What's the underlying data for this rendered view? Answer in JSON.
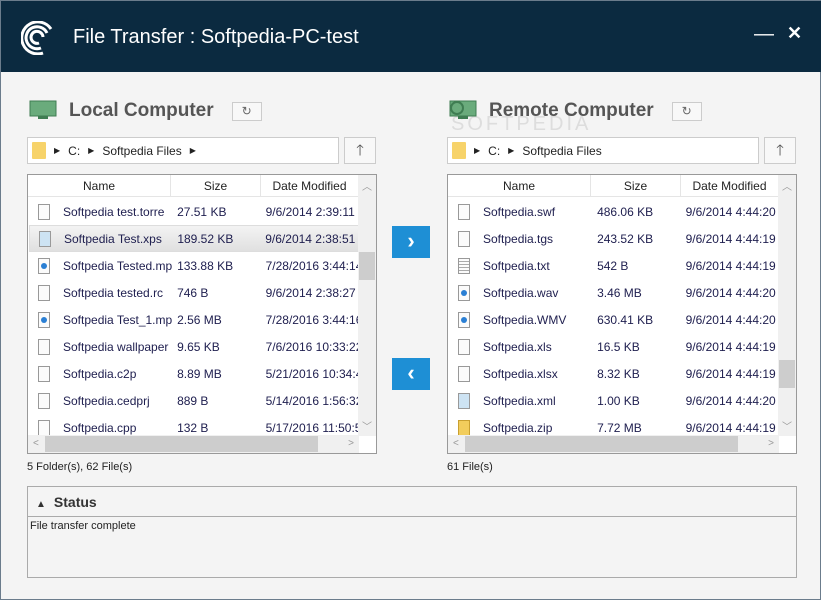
{
  "window": {
    "title": "File Transfer : Softpedia-PC-test",
    "minimize": "—",
    "close": "✕"
  },
  "local": {
    "title": "Local Computer",
    "refresh": "↻",
    "crumbs": [
      "C:",
      "Softpedia Files"
    ],
    "up": "🡑",
    "columns": [
      "Name",
      "Size",
      "Date Modified"
    ],
    "rows": [
      {
        "icon": "file",
        "name": "Softpedia test.torre",
        "size": "27.51 KB",
        "date": "9/6/2014 2:39:11"
      },
      {
        "icon": "img",
        "name": "Softpedia Test.xps",
        "size": "189.52 KB",
        "date": "9/6/2014 2:38:51",
        "selected": true
      },
      {
        "icon": "media",
        "name": "Softpedia Tested.mp",
        "size": "133.88 KB",
        "date": "7/28/2016 3:44:14"
      },
      {
        "icon": "file",
        "name": "Softpedia tested.rc",
        "size": "746 B",
        "date": "9/6/2014 2:38:27"
      },
      {
        "icon": "media",
        "name": "Softpedia Test_1.mp",
        "size": "2.56 MB",
        "date": "7/28/2016 3:44:16"
      },
      {
        "icon": "file",
        "name": "Softpedia wallpaper",
        "size": "9.65 KB",
        "date": "7/6/2016 10:33:22"
      },
      {
        "icon": "file",
        "name": "Softpedia.c2p",
        "size": "8.89 MB",
        "date": "5/21/2016 10:34:4"
      },
      {
        "icon": "file",
        "name": "Softpedia.cedprj",
        "size": "889 B",
        "date": "5/14/2016 1:56:32"
      },
      {
        "icon": "file",
        "name": "Softpedia.cpp",
        "size": "132 B",
        "date": "5/17/2016 11:50:5"
      }
    ],
    "footer": "5 Folder(s), 62 File(s)",
    "scroll_position": 0.3
  },
  "remote": {
    "title": "Remote Computer",
    "refresh": "↻",
    "crumbs": [
      "C:",
      "Softpedia Files"
    ],
    "up": "🡑",
    "columns": [
      "Name",
      "Size",
      "Date Modified"
    ],
    "rows": [
      {
        "icon": "file",
        "name": "Softpedia.swf",
        "size": "486.06 KB",
        "date": "9/6/2014 4:44:20"
      },
      {
        "icon": "file",
        "name": "Softpedia.tgs",
        "size": "243.52 KB",
        "date": "9/6/2014 4:44:19"
      },
      {
        "icon": "txt",
        "name": "Softpedia.txt",
        "size": "542 B",
        "date": "9/6/2014 4:44:19"
      },
      {
        "icon": "media",
        "name": "Softpedia.wav",
        "size": "3.46 MB",
        "date": "9/6/2014 4:44:20"
      },
      {
        "icon": "media",
        "name": "Softpedia.WMV",
        "size": "630.41 KB",
        "date": "9/6/2014 4:44:20"
      },
      {
        "icon": "file",
        "name": "Softpedia.xls",
        "size": "16.5 KB",
        "date": "9/6/2014 4:44:19"
      },
      {
        "icon": "file",
        "name": "Softpedia.xlsx",
        "size": "8.32 KB",
        "date": "9/6/2014 4:44:19"
      },
      {
        "icon": "img",
        "name": "Softpedia.xml",
        "size": "1.00 KB",
        "date": "9/6/2014 4:44:20"
      },
      {
        "icon": "zip",
        "name": "Softpedia.zip",
        "size": "7.72 MB",
        "date": "9/6/2014 4:44:19"
      }
    ],
    "footer": "61 File(s)",
    "scroll_position": 0.85
  },
  "transfer": {
    "upload": "›",
    "download": "‹"
  },
  "status": {
    "title": "Status",
    "message": "File transfer complete"
  },
  "watermark": "SOFTPEDIA"
}
